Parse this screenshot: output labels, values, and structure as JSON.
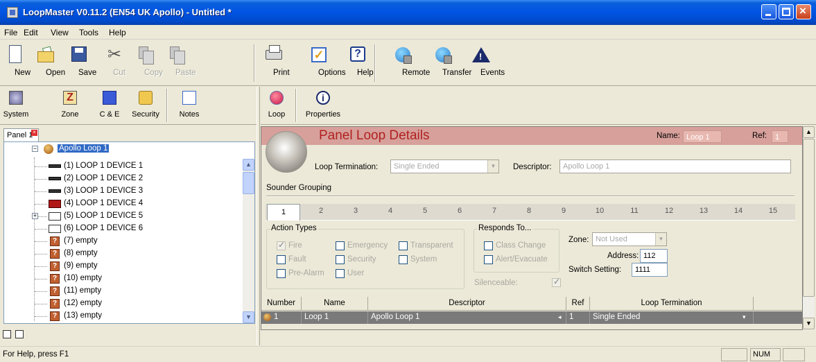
{
  "window": {
    "title": "LoopMaster V0.11.2 (EN54 UK Apollo) - Untitled *"
  },
  "menu": [
    "File",
    "Edit",
    "View",
    "Tools",
    "Help"
  ],
  "toolbar": {
    "new": "New",
    "open": "Open",
    "save": "Save",
    "cut": "Cut",
    "copy": "Copy",
    "paste": "Paste",
    "print": "Print",
    "options": "Options",
    "help": "Help",
    "remote": "Remote",
    "transfer": "Transfer",
    "events": "Events"
  },
  "left_toolbar": {
    "system": "System",
    "zone": "Zone",
    "ce": "C & E",
    "security": "Security",
    "notes": "Notes"
  },
  "panel_tab": "Panel 1",
  "tree": {
    "root": "Apollo Loop 1",
    "items": [
      "(1) LOOP 1 DEVICE 1",
      "(2) LOOP 1 DEVICE 2",
      "(3) LOOP 1 DEVICE 3",
      "(4) LOOP 1 DEVICE 4",
      "(5) LOOP 1 DEVICE 5",
      "(6) LOOP 1 DEVICE 6",
      "(7) empty",
      "(8) empty",
      "(9) empty",
      "(10) empty",
      "(11) empty",
      "(12) empty",
      "(13) empty"
    ]
  },
  "right_toolbar": {
    "loop": "Loop",
    "properties": "Properties"
  },
  "details": {
    "title": "Panel Loop Details",
    "name_label": "Name:",
    "name_value": "Loop 1",
    "ref_label": "Ref:",
    "ref_value": "1",
    "loop_termination_label": "Loop Termination:",
    "loop_termination_value": "Single Ended",
    "descriptor_label": "Descriptor:",
    "descriptor_value": "Apollo Loop 1",
    "sounder_grouping": "Sounder Grouping",
    "tabs": [
      "1",
      "2",
      "3",
      "4",
      "5",
      "6",
      "7",
      "8",
      "9",
      "10",
      "11",
      "12",
      "13",
      "14",
      "15"
    ],
    "action_types": {
      "title": "Action Types",
      "fire": "Fire",
      "emergency": "Emergency",
      "transparent": "Transparent",
      "fault": "Fault",
      "security": "Security",
      "system": "System",
      "prealarm": "Pre-Alarm",
      "user": "User"
    },
    "responds_to": {
      "title": "Responds To...",
      "class_change": "Class Change",
      "alert_evacuate": "Alert/Evacuate"
    },
    "silenceable_label": "Silenceable:",
    "zone_label": "Zone:",
    "zone_value": "Not Used",
    "address_label": "Address:",
    "address_value": "112",
    "switch_label": "Switch Setting:",
    "switch_value": "1111"
  },
  "grid": {
    "headers": [
      "Number",
      "Name",
      "Descriptor",
      "Ref",
      "Loop Termination"
    ],
    "row": {
      "number": "1",
      "name": "Loop 1",
      "descriptor": "Apollo Loop 1",
      "ref": "1",
      "termination": "Single Ended"
    }
  },
  "status": {
    "text": "For Help, press F1",
    "num": "NUM"
  },
  "colors": {
    "titlebar": "#0054e3",
    "header_band": "#d7a09a",
    "header_title": "#b02020",
    "selection": "#316ac5"
  }
}
